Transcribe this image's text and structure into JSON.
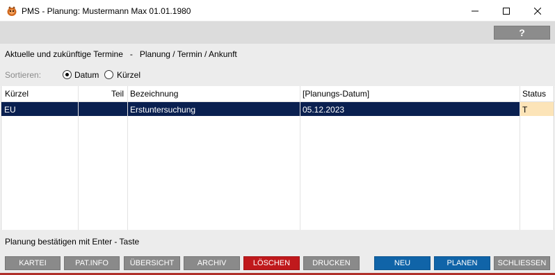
{
  "window": {
    "title": "PMS - Planung: Mustermann Max     01.01.1980",
    "app_icon": "pms-logo-icon",
    "controls": [
      "minimize-icon",
      "maximize-icon",
      "close-icon"
    ]
  },
  "toolbar": {
    "help_label": "?"
  },
  "heading": {
    "text": "Aktuelle und zukünftige Termine   -   Planung / Termin / Ankunft"
  },
  "sort": {
    "label": "Sortieren:",
    "options": [
      {
        "label": "Datum",
        "selected": true
      },
      {
        "label": "Kürzel",
        "selected": false
      }
    ]
  },
  "table": {
    "columns": [
      "Kürzel",
      "Teil",
      "Bezeichnung",
      "[Planungs-Datum]",
      "Status"
    ],
    "rows": [
      {
        "kuerzel": "EU",
        "teil": "",
        "bezeichnung": "Erstuntersuchung",
        "datum": "05.12.2023",
        "status": "T"
      }
    ],
    "selected_row_color": "#0a2050",
    "status_cell_color": "#fce4b8"
  },
  "status_bar": {
    "text": "Planung bestätigen mit Enter - Taste"
  },
  "buttons": {
    "kartei": "KARTEI",
    "patinfo": "PAT.INFO",
    "uebersicht": "ÜBERSICHT",
    "archiv": "ARCHIV",
    "loeschen": "LÖSCHEN",
    "drucken": "DRUCKEN",
    "neu": "NEU",
    "planen": "PLANEN",
    "schliessen": "SCHLIESSEN"
  },
  "colors": {
    "button_gray": "#8a8a8a",
    "button_red": "#c0191c",
    "button_blue": "#1064a8"
  }
}
